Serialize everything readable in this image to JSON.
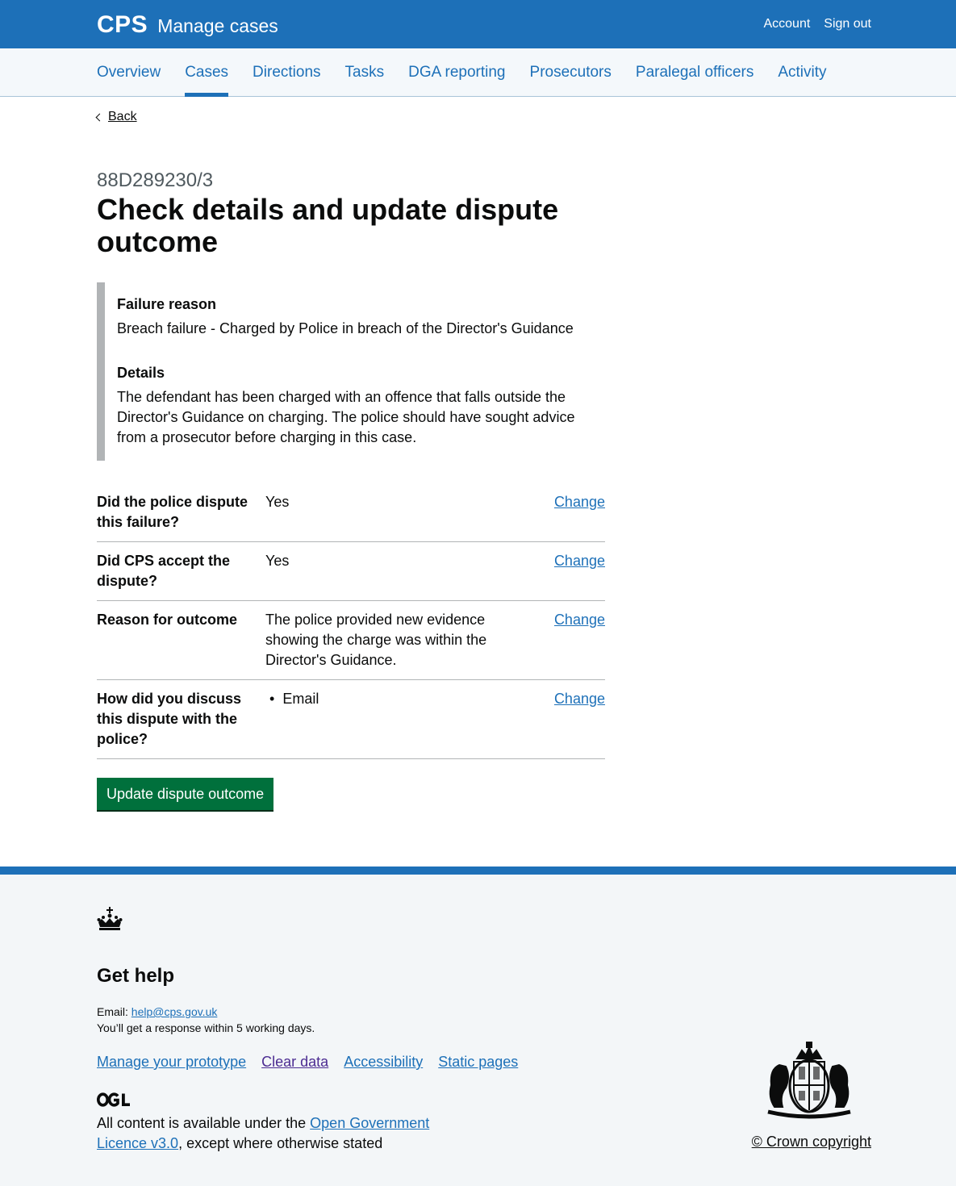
{
  "header": {
    "org": "CPS",
    "service": "Manage cases",
    "account": "Account",
    "sign_out": "Sign out"
  },
  "nav": {
    "items": [
      {
        "label": "Overview"
      },
      {
        "label": "Cases",
        "active": true
      },
      {
        "label": "Directions"
      },
      {
        "label": "Tasks"
      },
      {
        "label": "DGA reporting"
      },
      {
        "label": "Prosecutors"
      },
      {
        "label": "Paralegal officers"
      },
      {
        "label": "Activity"
      }
    ]
  },
  "back": "Back",
  "page": {
    "caption": "88D289230/3",
    "title": "Check details and update dispute outcome"
  },
  "inset": {
    "failure_heading": "Failure reason",
    "failure_text": "Breach failure - Charged by Police in breach of the Director's Guidance",
    "details_heading": "Details",
    "details_text": "The defendant has been charged with an offence that falls outside the Director's Guidance on charging. The police should have sought advice from a prosecutor before charging in this case."
  },
  "summary": [
    {
      "key": "Did the police dispute this failure?",
      "value": "Yes",
      "action": "Change"
    },
    {
      "key": "Did CPS accept the dispute?",
      "value": "Yes",
      "action": "Change"
    },
    {
      "key": "Reason for outcome",
      "value": "The police provided new evidence showing the charge was within the Director's Guidance.",
      "action": "Change"
    },
    {
      "key": "How did you discuss this dispute with the police?",
      "bullet": "Email",
      "action": "Change"
    }
  ],
  "button": "Update dispute outcome",
  "footer": {
    "help_title": "Get help",
    "email_label": "Email: ",
    "email": "help@cps.gov.uk",
    "note": "You’ll get a response within 5 working days.",
    "links": {
      "manage": "Manage your prototype",
      "clear": "Clear data",
      "accessibility": "Accessibility",
      "static": "Static pages"
    },
    "licence_pre": "All content is available under the ",
    "licence_link": "Open Government Licence v3.0",
    "licence_post": ", except where otherwise stated",
    "copyright": "© Crown copyright"
  },
  "colors": {
    "brand_blue": "#1d70b8",
    "button_green": "#00703c",
    "visited_link": "#4c2c92"
  }
}
